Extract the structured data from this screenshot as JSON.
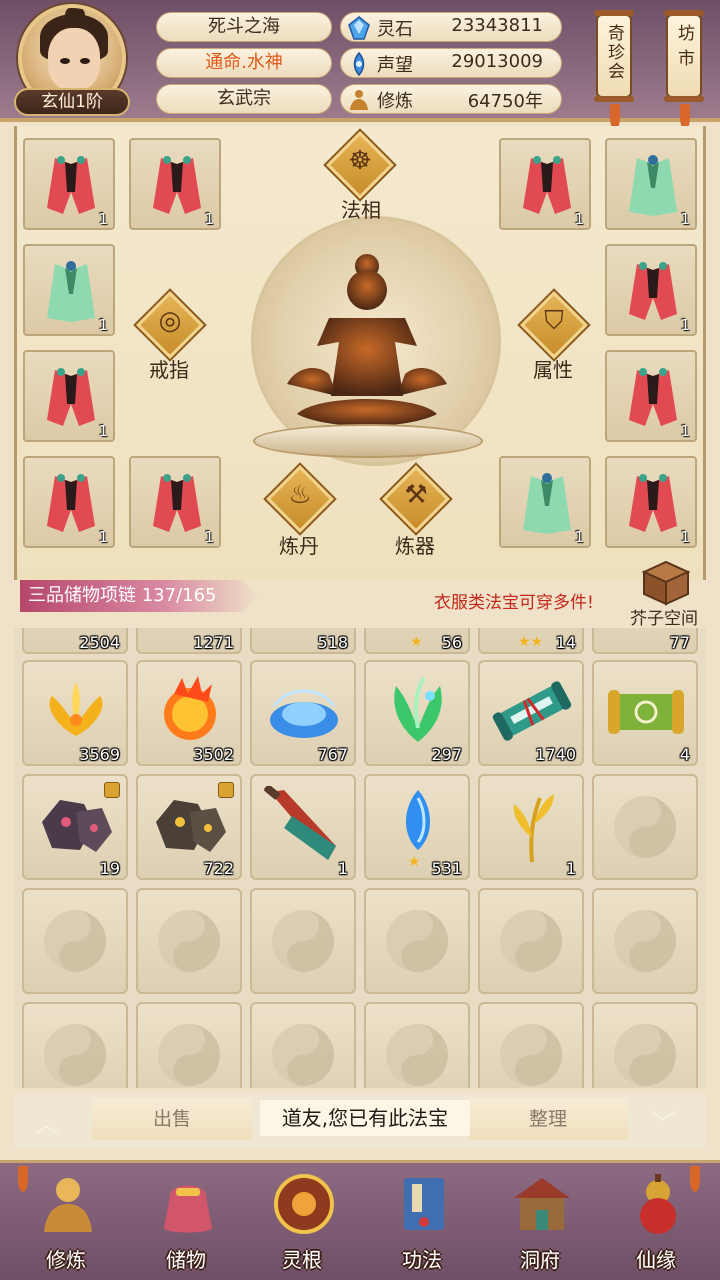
{
  "colors": {
    "accent": "#e25a1b",
    "notice": "#c4281c",
    "bag_title_bg": "#b6476a",
    "header_bg": "#6e4f66"
  },
  "player": {
    "rank": "玄仙1阶",
    "region": "死斗之海",
    "fate": "通命.水神",
    "sect": "玄武宗"
  },
  "resources": [
    {
      "icon": "spirit-stone-icon",
      "label": "灵石",
      "value": "23343811"
    },
    {
      "icon": "prestige-icon",
      "label": "声望",
      "value": "29013009"
    },
    {
      "icon": "cultivation-icon",
      "label": "修炼",
      "value": "64750年"
    }
  ],
  "top_buttons": {
    "treasure_shop": "奇珍会",
    "market": "坊市"
  },
  "equip_slots": {
    "left": [
      {
        "count": "1",
        "robe": "red"
      },
      {
        "count": "1",
        "robe": "red"
      },
      {
        "count": "1",
        "robe": "green"
      },
      {
        "count": "1",
        "robe": "red"
      },
      {
        "count": "1",
        "robe": "red"
      },
      {
        "count": "1",
        "robe": "red"
      }
    ],
    "right": [
      {
        "count": "1",
        "robe": "red"
      },
      {
        "count": "1",
        "robe": "green"
      },
      {
        "count": "1",
        "robe": "red"
      },
      {
        "count": "1",
        "robe": "red"
      },
      {
        "count": "1",
        "robe": "green"
      },
      {
        "count": "1",
        "robe": "red"
      }
    ]
  },
  "center_buttons": {
    "dharma_form": "法相",
    "ring": "戒指",
    "attributes": "属性",
    "alchemy": "炼丹",
    "refining": "炼器"
  },
  "bag": {
    "title": "三品储物项链",
    "capacity": "137/165",
    "notice": "衣服类法宝可穿多件!",
    "mustard_space": "芥子空间"
  },
  "inventory": {
    "row0_counts": [
      "2504",
      "1271",
      "518",
      "56",
      "14",
      "77"
    ],
    "row1": [
      {
        "name": "golden-flower",
        "count": "3569"
      },
      {
        "name": "fire-flower",
        "count": "3502"
      },
      {
        "name": "water-orb",
        "count": "767"
      },
      {
        "name": "green-herb",
        "count": "297"
      },
      {
        "name": "jade-scroll",
        "count": "1740"
      },
      {
        "name": "gold-scroll",
        "count": "4"
      }
    ],
    "row2": [
      {
        "name": "dark-ore",
        "count": "19",
        "locked": true
      },
      {
        "name": "gold-ore",
        "count": "722",
        "locked": true
      },
      {
        "name": "demon-blade",
        "count": "1",
        "locked": false
      },
      {
        "name": "blue-crystal",
        "count": "531",
        "locked": false
      },
      {
        "name": "golden-grass",
        "count": "1",
        "locked": false
      }
    ]
  },
  "actions": {
    "sell": "出售",
    "organize": "整理"
  },
  "toast": "道友,您已有此法宝",
  "nav": [
    {
      "key": "cultivate",
      "label": "修炼",
      "color": "#c98a3a"
    },
    {
      "key": "storage",
      "label": "储物",
      "color": "#d2566a"
    },
    {
      "key": "spirit-root",
      "label": "灵根",
      "color": "#8e3a1e"
    },
    {
      "key": "technique",
      "label": "功法",
      "color": "#3f6fb0"
    },
    {
      "key": "cave",
      "label": "洞府",
      "color": "#9a6b3a"
    },
    {
      "key": "fate",
      "label": "仙缘",
      "color": "#d9a436"
    }
  ]
}
